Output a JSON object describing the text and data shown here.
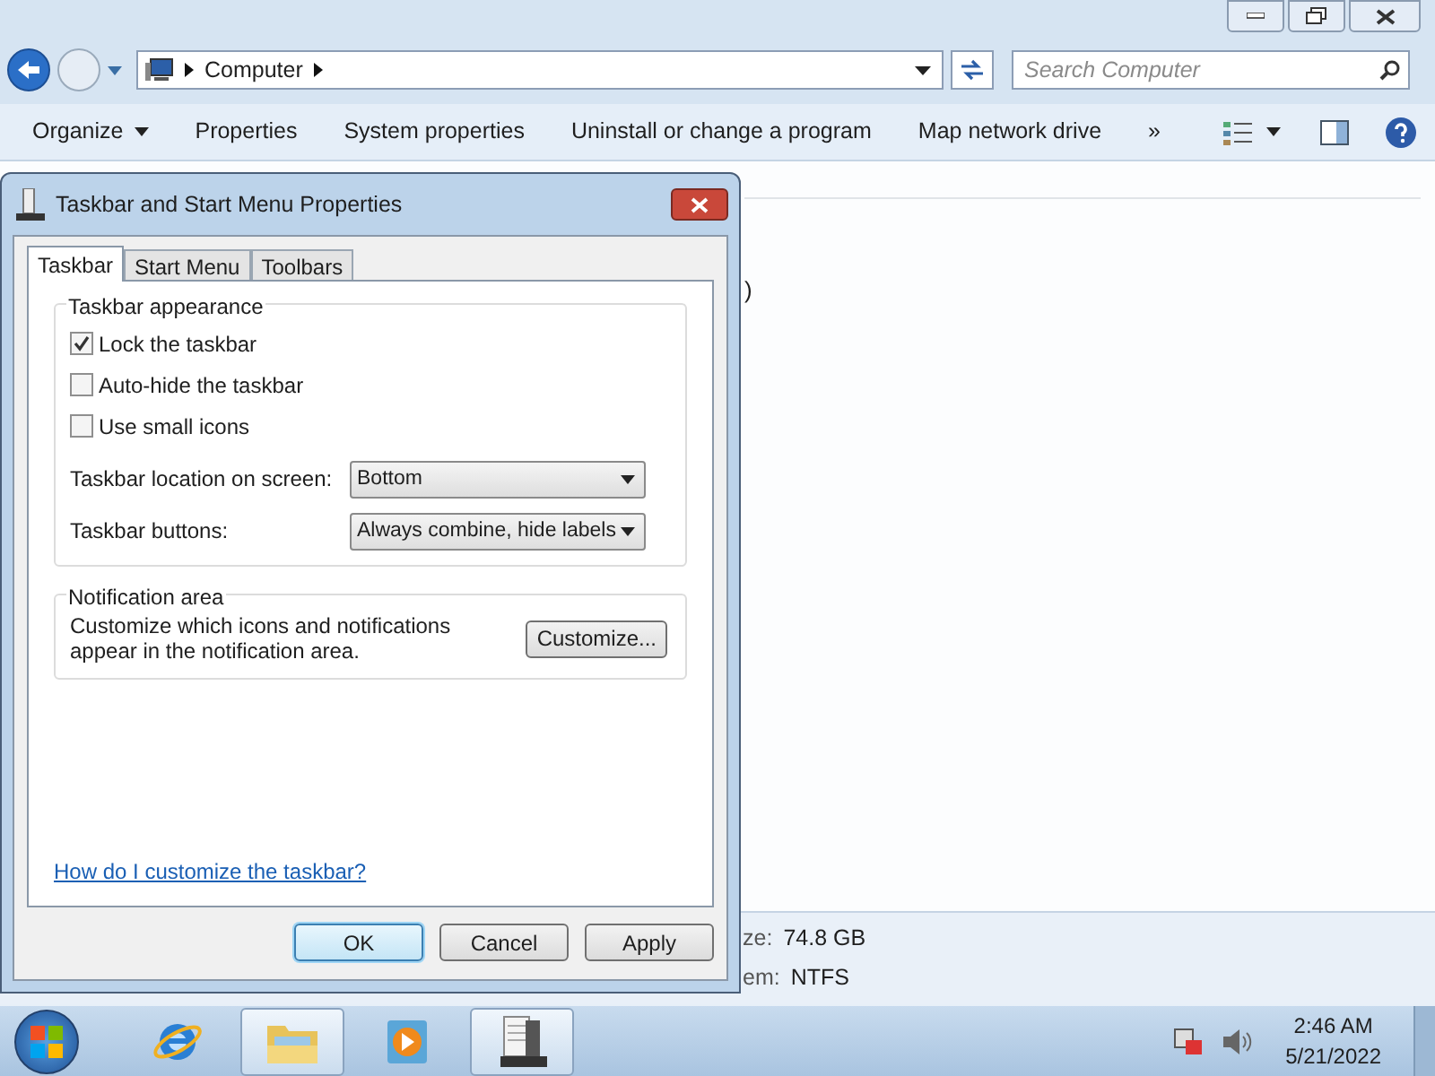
{
  "explorer": {
    "address": {
      "crumbs": [
        "Computer"
      ]
    },
    "search": {
      "placeholder": "Search Computer"
    },
    "toolbar": [
      {
        "label": "Organize",
        "dropdown": true
      },
      {
        "label": "Properties",
        "dropdown": false
      },
      {
        "label": "System properties",
        "dropdown": false
      },
      {
        "label": "Uninstall or change a program",
        "dropdown": false
      },
      {
        "label": "Map network drive",
        "dropdown": false
      },
      {
        "label": "»",
        "dropdown": false
      }
    ],
    "content_fragment": ")",
    "details": [
      {
        "label": "ze:",
        "value": "74.8 GB"
      },
      {
        "label": "em:",
        "value": "NTFS"
      }
    ]
  },
  "dialog": {
    "title": "Taskbar and Start Menu Properties",
    "tabs": [
      {
        "label": "Taskbar",
        "selected": true
      },
      {
        "label": "Start Menu",
        "selected": false
      },
      {
        "label": "Toolbars",
        "selected": false
      }
    ],
    "appearance": {
      "title": "Taskbar appearance",
      "checkboxes": [
        {
          "label": "Lock the taskbar",
          "checked": true
        },
        {
          "label": "Auto-hide the taskbar",
          "checked": false
        },
        {
          "label": "Use small icons",
          "checked": false
        }
      ],
      "selects": [
        {
          "label": "Taskbar location on screen:",
          "value": "Bottom"
        },
        {
          "label": "Taskbar buttons:",
          "value": "Always combine, hide labels"
        }
      ]
    },
    "notification": {
      "title": "Notification area",
      "text": "Customize which icons and notifications appear in the notification area.",
      "button": "Customize..."
    },
    "link": "How do I customize the taskbar?",
    "buttons": [
      {
        "label": "OK",
        "default": true
      },
      {
        "label": "Cancel",
        "default": false
      },
      {
        "label": "Apply",
        "default": false
      }
    ]
  },
  "taskbar": {
    "apps": [
      {
        "kind": "browser",
        "active": false
      },
      {
        "kind": "folder",
        "active": true
      },
      {
        "kind": "media",
        "active": false
      },
      {
        "kind": "server",
        "active": true
      }
    ],
    "time": "2:46 AM",
    "date": "5/21/2022"
  }
}
